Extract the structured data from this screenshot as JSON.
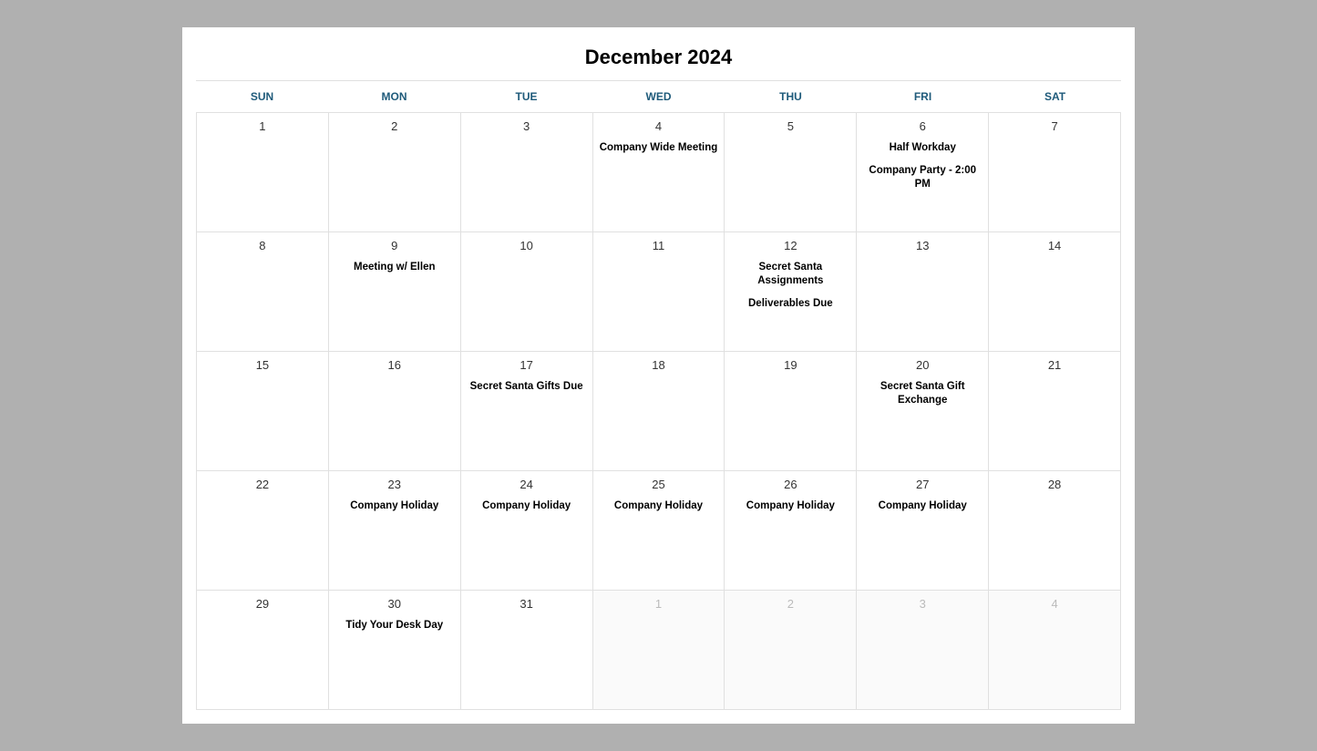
{
  "title": "December 2024",
  "dayHeaders": [
    "SUN",
    "MON",
    "TUE",
    "WED",
    "THU",
    "FRI",
    "SAT"
  ],
  "weeks": [
    [
      {
        "day": "1",
        "otherMonth": false,
        "events": []
      },
      {
        "day": "2",
        "otherMonth": false,
        "events": []
      },
      {
        "day": "3",
        "otherMonth": false,
        "events": []
      },
      {
        "day": "4",
        "otherMonth": false,
        "events": [
          "Company Wide Meeting"
        ]
      },
      {
        "day": "5",
        "otherMonth": false,
        "events": []
      },
      {
        "day": "6",
        "otherMonth": false,
        "events": [
          "Half Workday",
          "Company Party - 2:00 PM"
        ]
      },
      {
        "day": "7",
        "otherMonth": false,
        "events": []
      }
    ],
    [
      {
        "day": "8",
        "otherMonth": false,
        "events": []
      },
      {
        "day": "9",
        "otherMonth": false,
        "events": [
          "Meeting w/ Ellen"
        ]
      },
      {
        "day": "10",
        "otherMonth": false,
        "events": []
      },
      {
        "day": "11",
        "otherMonth": false,
        "events": []
      },
      {
        "day": "12",
        "otherMonth": false,
        "events": [
          "Secret Santa Assignments",
          "Deliverables Due"
        ]
      },
      {
        "day": "13",
        "otherMonth": false,
        "events": []
      },
      {
        "day": "14",
        "otherMonth": false,
        "events": []
      }
    ],
    [
      {
        "day": "15",
        "otherMonth": false,
        "events": []
      },
      {
        "day": "16",
        "otherMonth": false,
        "events": []
      },
      {
        "day": "17",
        "otherMonth": false,
        "events": [
          "Secret Santa Gifts Due"
        ]
      },
      {
        "day": "18",
        "otherMonth": false,
        "events": []
      },
      {
        "day": "19",
        "otherMonth": false,
        "events": []
      },
      {
        "day": "20",
        "otherMonth": false,
        "events": [
          "Secret Santa Gift Exchange"
        ]
      },
      {
        "day": "21",
        "otherMonth": false,
        "events": []
      }
    ],
    [
      {
        "day": "22",
        "otherMonth": false,
        "events": []
      },
      {
        "day": "23",
        "otherMonth": false,
        "events": [
          "Company Holiday"
        ]
      },
      {
        "day": "24",
        "otherMonth": false,
        "events": [
          "Company Holiday"
        ]
      },
      {
        "day": "25",
        "otherMonth": false,
        "events": [
          "Company Holiday"
        ]
      },
      {
        "day": "26",
        "otherMonth": false,
        "events": [
          "Company Holiday"
        ]
      },
      {
        "day": "27",
        "otherMonth": false,
        "events": [
          "Company Holiday"
        ]
      },
      {
        "day": "28",
        "otherMonth": false,
        "events": []
      }
    ],
    [
      {
        "day": "29",
        "otherMonth": false,
        "events": []
      },
      {
        "day": "30",
        "otherMonth": false,
        "events": [
          "Tidy Your Desk Day"
        ]
      },
      {
        "day": "31",
        "otherMonth": false,
        "events": []
      },
      {
        "day": "1",
        "otherMonth": true,
        "events": []
      },
      {
        "day": "2",
        "otherMonth": true,
        "events": []
      },
      {
        "day": "3",
        "otherMonth": true,
        "events": []
      },
      {
        "day": "4",
        "otherMonth": true,
        "events": []
      }
    ]
  ]
}
